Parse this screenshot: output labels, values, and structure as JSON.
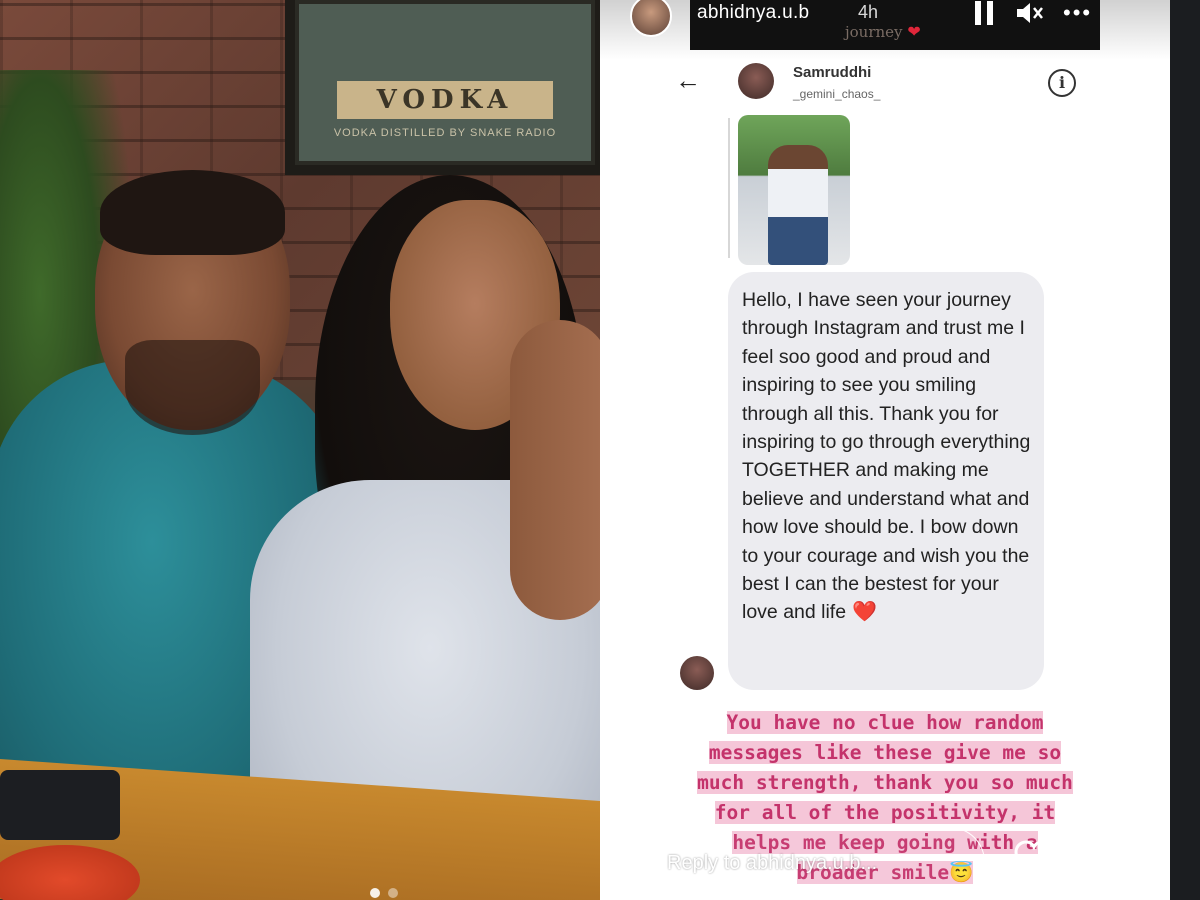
{
  "story": {
    "username": "abhidnya.u.b",
    "time": "4h",
    "caption_line": "journey",
    "caption_heart": "❤",
    "pause_icon": "pause-icon",
    "mute_icon": "mute-icon",
    "more_icon": "•••"
  },
  "dm": {
    "back_icon": "←",
    "name": "Samruddhi",
    "handle": "_gemini_chaos_",
    "info_icon": "i",
    "message": "Hello, I have seen your journey through Instagram and trust me I feel soo good and proud and inspiring to see you smiling through all this. Thank you for inspiring to go through everything TOGETHER and making me believe and understand what and how love should be. I bow down to your courage and wish you the best I can the bestest for your love and life",
    "message_heart": "❤️"
  },
  "overlay": {
    "lines": [
      "You have no clue how random",
      "messages like these give me so",
      "much strength, thank you so much",
      "for all of the positivity, it",
      "helps me  keep going with a",
      "broader smile😇"
    ]
  },
  "reply": {
    "placeholder": "Reply to abhidnya.u.b...",
    "heart_icon": "heart-icon",
    "send_icon": "send-icon"
  },
  "colors": {
    "overlay_text": "#c4336b",
    "overlay_highlight": "#f5c6d8",
    "bubble_bg": "#ececf0",
    "heart": "#e0263a"
  }
}
